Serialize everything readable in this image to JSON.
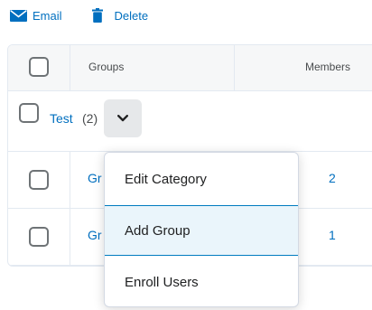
{
  "toolbar": {
    "email_label": "Email",
    "delete_label": "Delete",
    "icons": [
      "envelope-icon",
      "trash-icon"
    ]
  },
  "table": {
    "headers": {
      "groups": "Groups",
      "members": "Members"
    },
    "category": {
      "name": "Test",
      "count": "(2)"
    },
    "rows": [
      {
        "group": "Gr",
        "members": "2"
      },
      {
        "group": "Gr",
        "members": "1"
      }
    ]
  },
  "menu": {
    "items": [
      {
        "label": "Edit Category",
        "selected": false
      },
      {
        "label": "Add Group",
        "selected": true
      },
      {
        "label": "Enroll Users",
        "selected": false
      }
    ]
  },
  "colors": {
    "link": "#006fbf",
    "accent": "#007bbf",
    "selected_bg": "#eaf5fb",
    "header_bg": "#f6f7f8"
  }
}
